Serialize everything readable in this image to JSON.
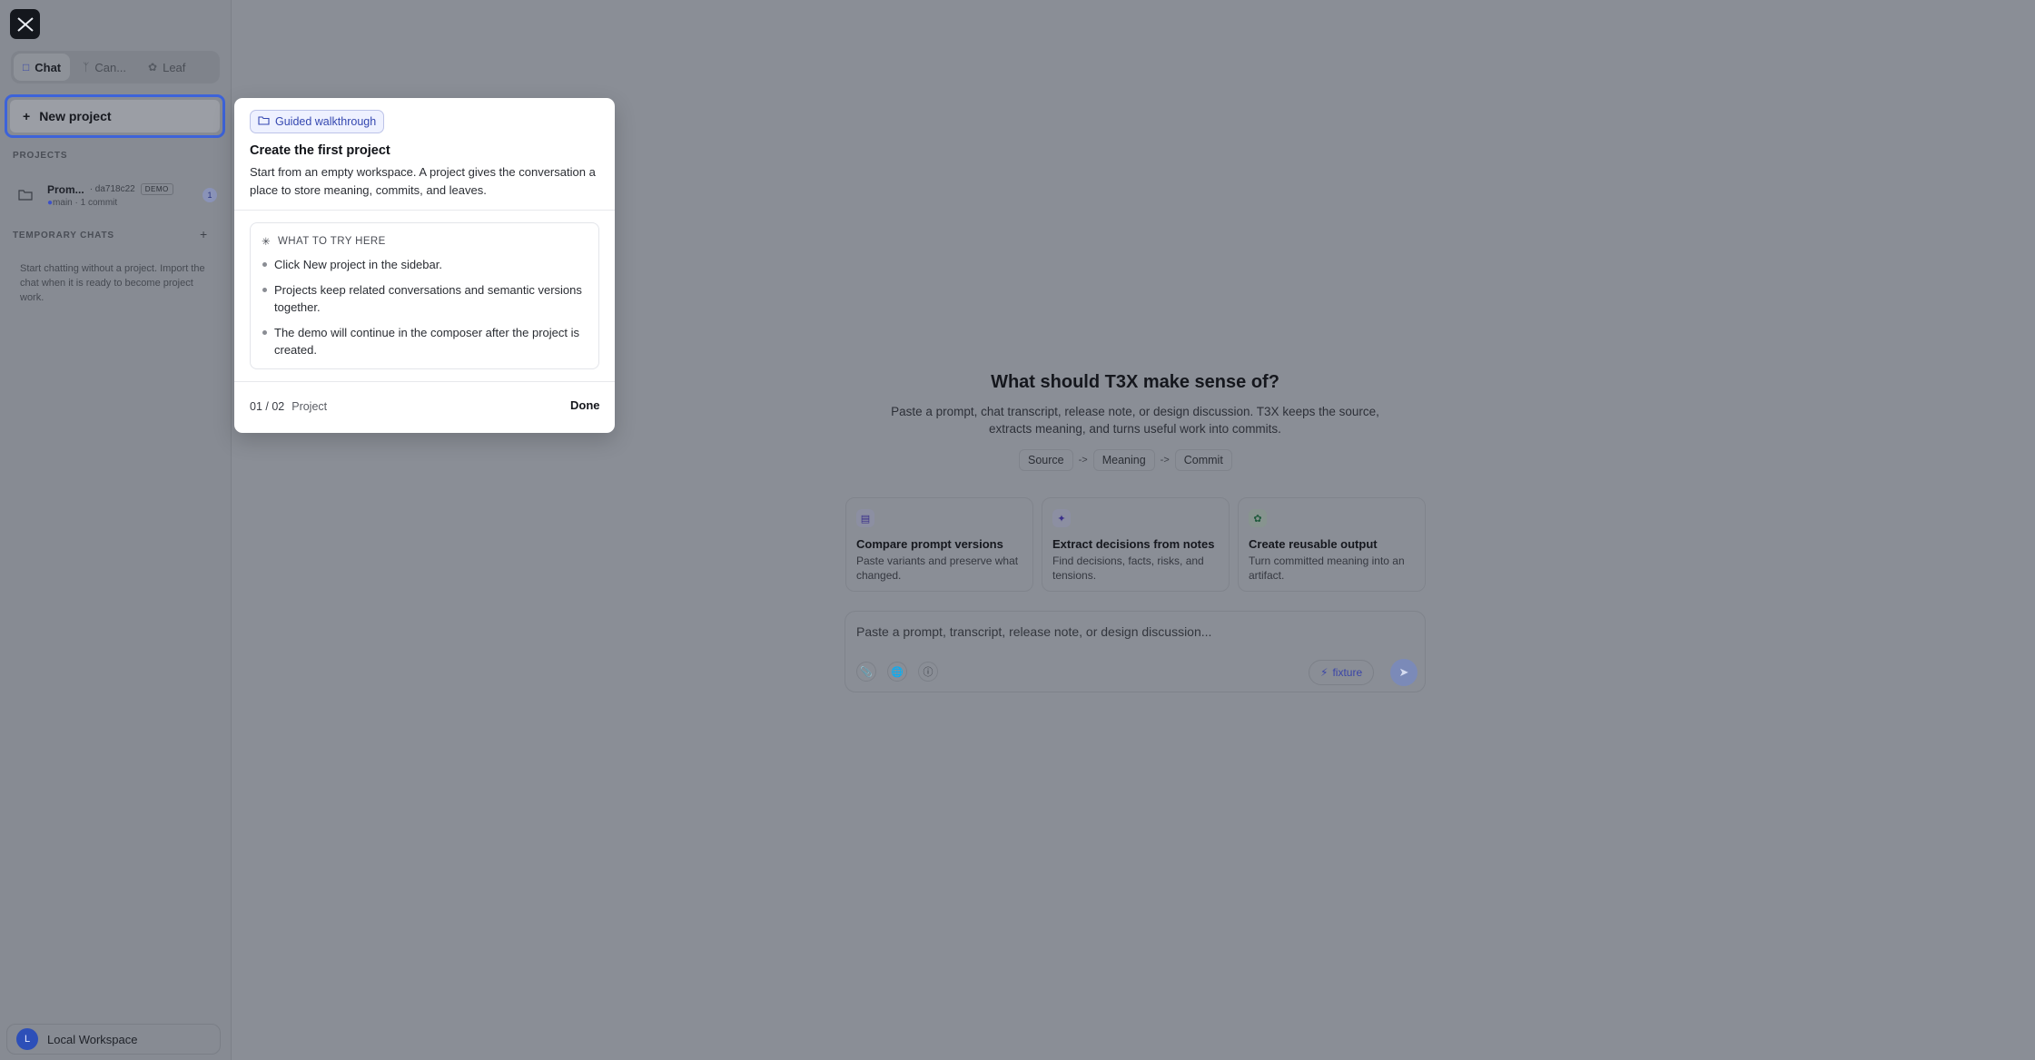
{
  "sidebar": {
    "tabs": [
      {
        "label": "Chat",
        "icon": "chat-bubble-icon",
        "active": true
      },
      {
        "label": "Can...",
        "icon": "branch-icon",
        "active": false
      },
      {
        "label": "Leaf",
        "icon": "leaf-icon",
        "active": false
      }
    ],
    "new_project_label": "New project",
    "projects_heading": "PROJECTS",
    "project": {
      "name": "Prom...",
      "hash": "· da718c22",
      "badge": "DEMO",
      "branch": "main",
      "commits": "· 1 commit",
      "count": "1"
    },
    "temp_heading": "TEMPORARY CHATS",
    "temp_text": "Start chatting without a project. Import the chat when it is ready to become project work.",
    "workspace": {
      "avatar": "L",
      "label": "Local Workspace"
    }
  },
  "main": {
    "title": "What should T3X make sense of?",
    "subtitle": "Paste a prompt, chat transcript, release note, or design discussion. T3X keeps the source, extracts meaning, and turns useful work into commits.",
    "flow": [
      "Source",
      "->",
      "Meaning",
      "->",
      "Commit"
    ],
    "cards": [
      {
        "title": "Compare prompt versions",
        "desc": "Paste variants and preserve what changed.",
        "icon": "document-icon"
      },
      {
        "title": "Extract decisions from notes",
        "desc": "Find decisions, facts, risks, and tensions.",
        "icon": "sparkle-icon"
      },
      {
        "title": "Create reusable output",
        "desc": "Turn committed meaning into an artifact.",
        "icon": "leaf-icon"
      }
    ],
    "composer": {
      "placeholder": "Paste a prompt, transcript, release note, or design discussion...",
      "fixture_label": "fixture"
    }
  },
  "popover": {
    "badge": "Guided walkthrough",
    "title": "Create the first project",
    "desc": "Start from an empty workspace. A project gives the conversation a place to store meaning, commits, and leaves.",
    "try_heading": "WHAT TO TRY HERE",
    "items": [
      "Click New project in the sidebar.",
      "Projects keep related conversations and semantic versions together.",
      "The demo will continue in the composer after the project is created."
    ],
    "step": "01 / 02",
    "step_label": "Project",
    "done_label": "Done"
  },
  "colors": {
    "accent": "#3d63d9",
    "overlay_bg": "#8a8e96",
    "popover_bg": "#ffffff"
  }
}
